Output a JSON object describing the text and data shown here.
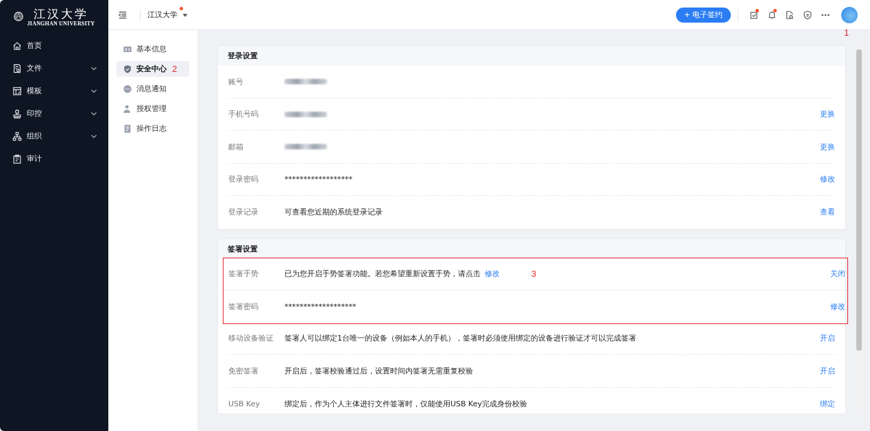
{
  "logo": {
    "name": "江汉大学",
    "subtitle": "JIANGHAN UNIVERSITY"
  },
  "nav": [
    {
      "label": "首页",
      "kind": "home",
      "expandable": false
    },
    {
      "label": "文件",
      "kind": "file",
      "expandable": true
    },
    {
      "label": "模板",
      "kind": "template",
      "expandable": true
    },
    {
      "label": "印控",
      "kind": "stamp",
      "expandable": true
    },
    {
      "label": "组织",
      "kind": "org",
      "expandable": true
    },
    {
      "label": "审计",
      "kind": "audit",
      "expandable": false
    }
  ],
  "header": {
    "org": "江汉大学",
    "org_badge": true,
    "primary_button": {
      "icon": "+",
      "label": "电子签约"
    },
    "icons": [
      {
        "kind": "todo",
        "badge": true
      },
      {
        "kind": "bell",
        "badge": true
      },
      {
        "kind": "docsearch",
        "badge": false
      },
      {
        "kind": "shield",
        "badge": false
      },
      {
        "kind": "more",
        "badge": false
      }
    ],
    "avatar_annotation": "1"
  },
  "settings_menu": [
    {
      "label": "基本信息",
      "kind": "card",
      "selected": false
    },
    {
      "label": "安全中心",
      "kind": "shield",
      "selected": true,
      "annotation": "2"
    },
    {
      "label": "消息通知",
      "kind": "chat",
      "selected": false
    },
    {
      "label": "授权管理",
      "kind": "user",
      "selected": false
    },
    {
      "label": "操作日志",
      "kind": "log",
      "selected": false
    }
  ],
  "sections": [
    {
      "title": "登录设置",
      "rows": [
        {
          "label": "账号",
          "kind": "redacted",
          "highlighted": false
        },
        {
          "label": "手机号码",
          "kind": "redacted",
          "action": "更换",
          "highlighted": false
        },
        {
          "label": "邮箱",
          "kind": "redacted",
          "action": "更换",
          "highlighted": false
        },
        {
          "label": "登录密码",
          "kind": "text",
          "text": "******************",
          "action": "修改",
          "highlighted": false
        },
        {
          "label": "登录记录",
          "kind": "text",
          "text": "可查看您近期的系统登录记录",
          "action": "查看",
          "highlighted": false
        }
      ]
    },
    {
      "title": "签署设置",
      "rows": [
        {
          "label": "签署手势",
          "kind": "text",
          "text": "已为您开启手势签署功能。若您希望重新设置手势，请点击",
          "link": "修改",
          "action": "关闭",
          "highlighted": true,
          "annotation": "3"
        },
        {
          "label": "签署密码",
          "kind": "text",
          "text": "*******************",
          "action": "修改",
          "highlighted": true
        },
        {
          "label": "移动设备验证",
          "kind": "text",
          "text": "签署人可以绑定1台唯一的设备（例如本人的手机），签署时必须使用绑定的设备进行验证才可以完成签署",
          "action": "开启",
          "highlighted": false
        },
        {
          "label": "免密签署",
          "kind": "text",
          "text": "开启后，签署校验通过后，设置时间内签署无需重复校验",
          "action": "开启",
          "highlighted": false
        },
        {
          "label": "USB Key",
          "kind": "text",
          "text": "绑定后，作为个人主体进行文件签署时，仅能使用USB Key完成身份校验",
          "action": "绑定",
          "highlighted": false
        }
      ]
    }
  ]
}
